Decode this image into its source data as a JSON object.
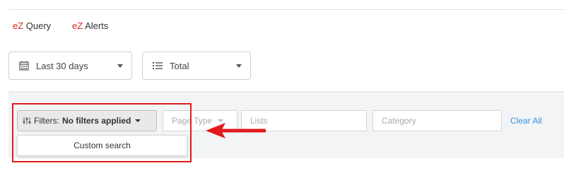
{
  "nav": {
    "query": {
      "prefix": "eZ",
      "label": " Query"
    },
    "alerts": {
      "prefix": "eZ",
      "label": " Alerts"
    }
  },
  "toolbar": {
    "date_range": {
      "icon": "calendar-icon",
      "value": "Last 30 days"
    },
    "metric": {
      "icon": "list-icon",
      "value": "Total"
    }
  },
  "filters": {
    "button_prefix": "Filters:",
    "button_status": "No filters applied",
    "icon": "sliders-icon",
    "page_type_placeholder": "Page Type",
    "lists_placeholder": "Lists",
    "category_placeholder": "Category",
    "clear_all": "Clear All"
  },
  "dropdown_menu": {
    "items": [
      {
        "label": "Custom search"
      }
    ]
  },
  "colors": {
    "brand": "#d9251c",
    "annotation": "#e01a1a",
    "link": "#3a8ed8"
  }
}
